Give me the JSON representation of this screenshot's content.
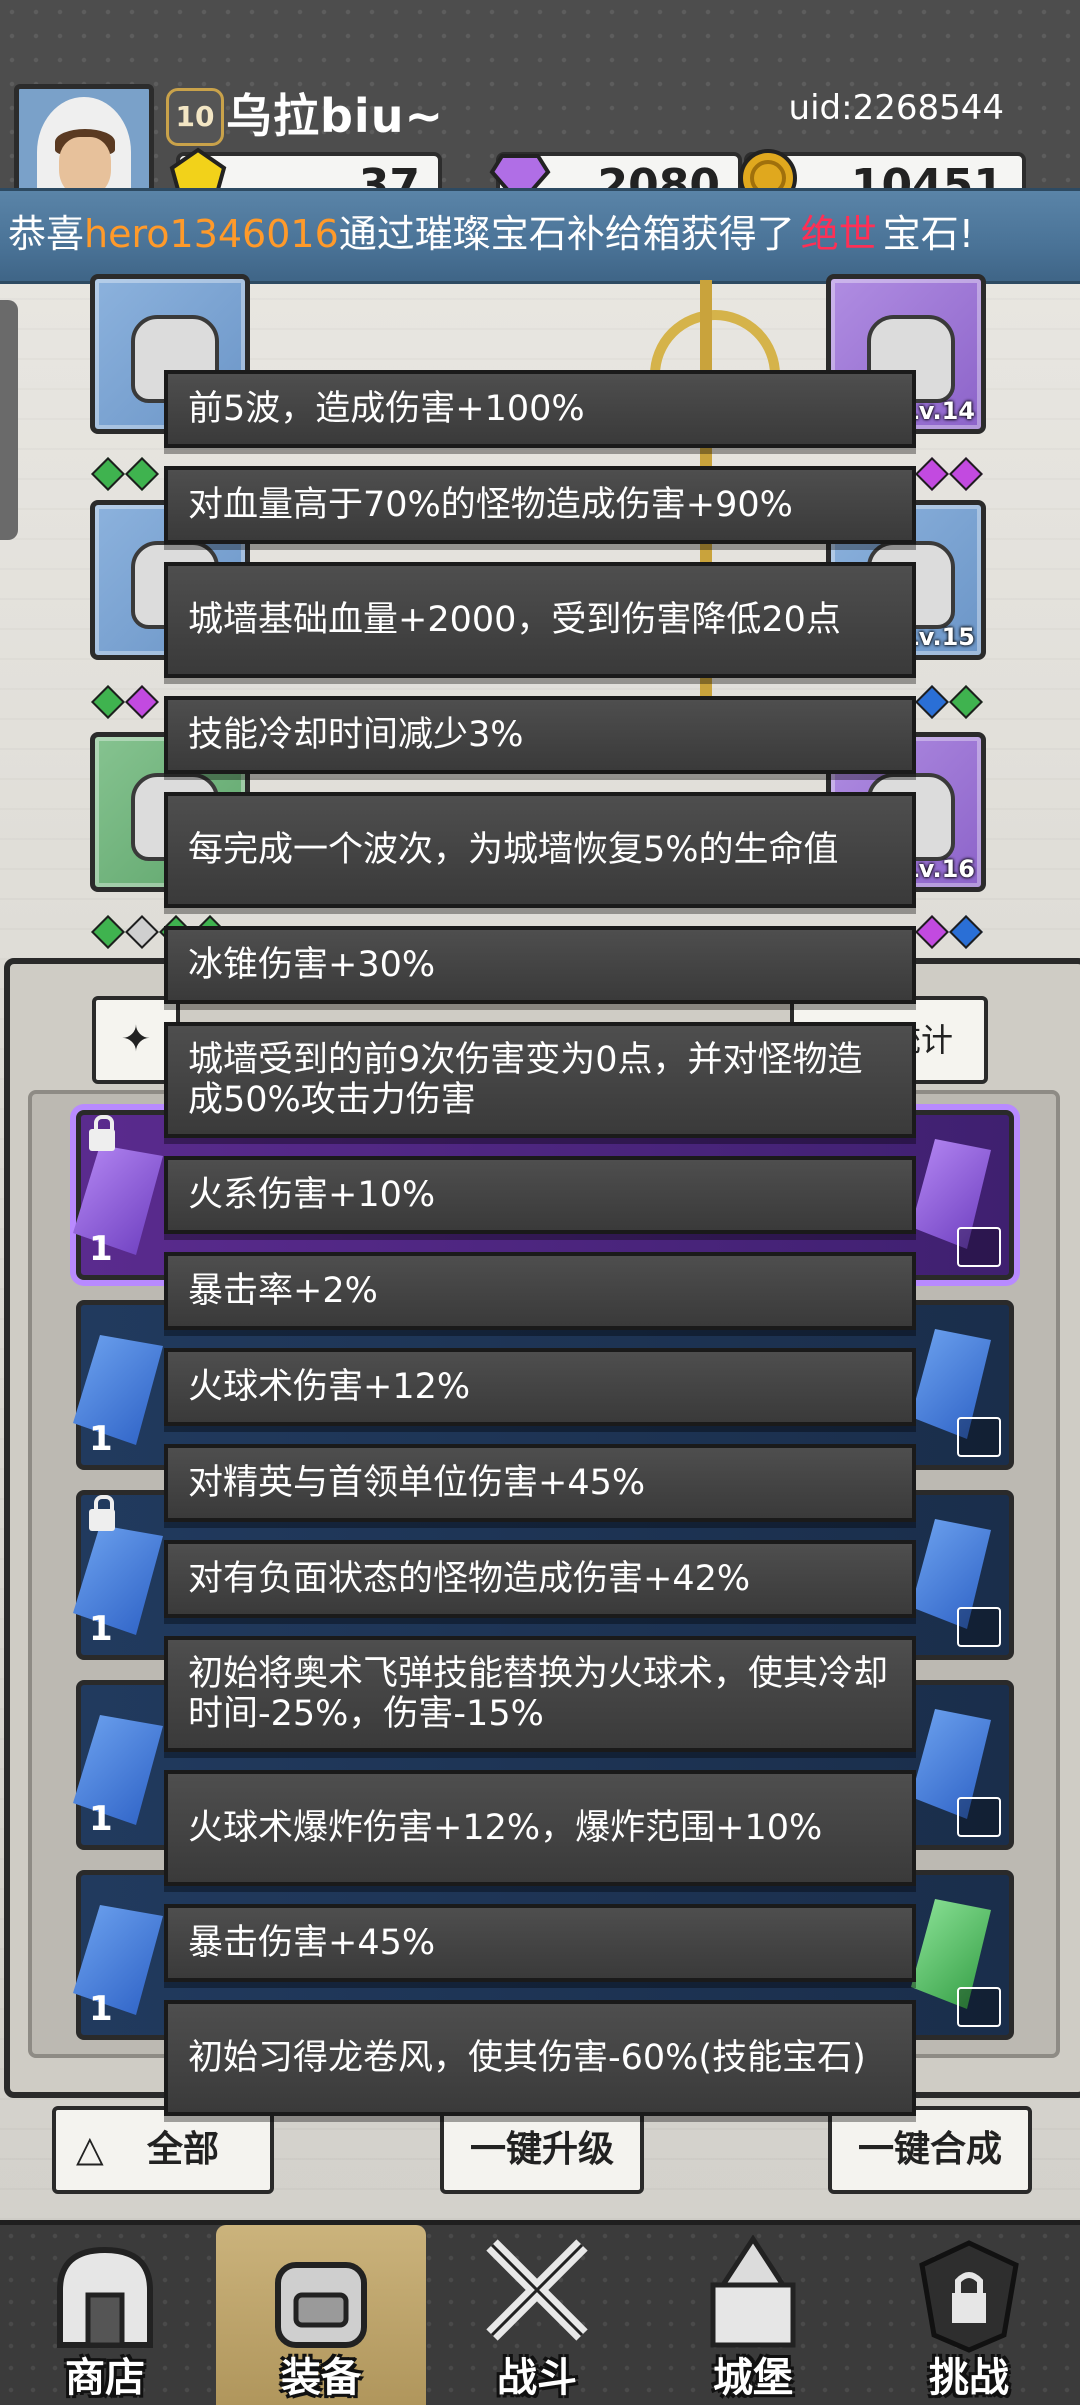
{
  "header": {
    "player_level": "10",
    "player_name": "乌拉biu~",
    "uid": "uid:2268544",
    "resources": [
      {
        "icon": "gold-gem-icon",
        "value": "37"
      },
      {
        "icon": "diamond-icon",
        "value": "2080"
      },
      {
        "icon": "coin-icon",
        "value": "10451"
      }
    ]
  },
  "marquee": {
    "prefix": "恭喜",
    "player": "hero1346016",
    "middle": "通过璀璨宝石补给箱获得了",
    "quality": "绝世",
    "suffix": "宝石!"
  },
  "equipment_levels": {
    "weapon": "Lv.14",
    "ring": "Lv.15",
    "necklace": "Lv.16"
  },
  "tabs": {
    "stats": "属性统计"
  },
  "gem_rows": [
    "1",
    "1",
    "1",
    "1",
    "1"
  ],
  "actions": {
    "filter": "全部",
    "upgrade": "一键升级",
    "merge": "一键合成"
  },
  "nav": [
    {
      "label": "商店",
      "icon": "shop-icon"
    },
    {
      "label": "装备",
      "icon": "backpack-icon"
    },
    {
      "label": "战斗",
      "icon": "crossed-swords-icon"
    },
    {
      "label": "城堡",
      "icon": "castle-icon"
    },
    {
      "label": "挑战",
      "icon": "locked-challenge-icon"
    }
  ],
  "tooltip": [
    "前5波，造成伤害+100%",
    "对血量高于70%的怪物造成伤害+90%",
    "城墙基础血量+2000，受到伤害降低20点",
    "技能冷却时间减少3%",
    "每完成一个波次，为城墙恢复5%的生命值",
    "冰锥伤害+30%",
    "城墙受到的前9次伤害变为0点，并对怪物造成50%攻击力伤害",
    "火系伤害+10%",
    "暴击率+2%",
    "火球术伤害+12%",
    "对精英与首领单位伤害+45%",
    "对有负面状态的怪物造成伤害+42%",
    "初始将奥术飞弹技能替换为火球术，使其冷却时间-25%，伤害-15%",
    "火球术爆炸伤害+12%，爆炸范围+10%",
    "暴击伤害+45%",
    "初始习得龙卷风，使其伤害-60%(技能宝石)"
  ],
  "colors": {
    "marquee_bg": "#4a7397",
    "highlight_player": "#ff9a2a",
    "highlight_quality": "#ff2f55",
    "tooltip_bg": "#444444"
  }
}
